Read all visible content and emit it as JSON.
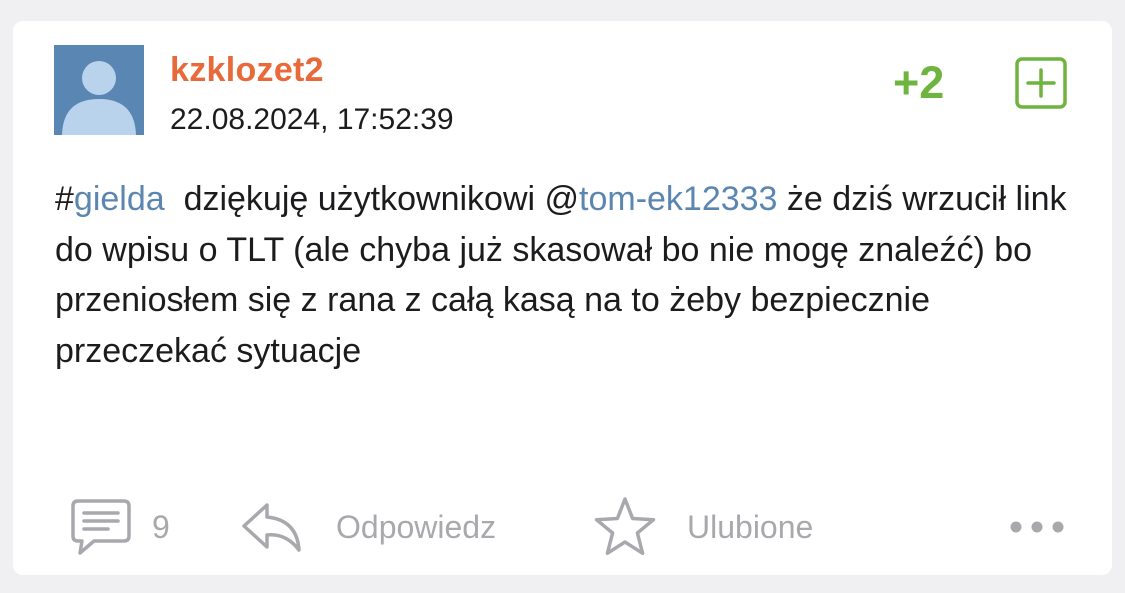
{
  "post": {
    "author": "kzklozet2",
    "timestamp": "22.08.2024, 17:52:39",
    "score": "+2",
    "body": {
      "hash": "#",
      "tag": "gielda",
      "text_1": "  dziękuję użytkownikowi @",
      "mention": "tom-ek12333",
      "text_2": " że dziś wrzucił link do wpisu o TLT (ale chyba już skasował bo nie mogę znaleźć) bo przeniosłem się z rana z całą kasą na to żeby bezpiecznie przeczekać sytuacje"
    }
  },
  "actions": {
    "comments_count": "9",
    "reply_label": "Odpowiedz",
    "favorite_label": "Ulubione"
  },
  "colors": {
    "author": "#e8693a",
    "score": "#6fb43f",
    "link": "#5b86b0",
    "muted": "#a9a9ad",
    "avatar_bg": "#5a86b3"
  },
  "icons": {
    "avatar": "default-user-silhouette",
    "upvote": "plus-square-icon",
    "comments": "speech-bubble-icon",
    "reply": "reply-arrow-icon",
    "favorite": "star-icon",
    "more": "more-dots-icon"
  }
}
